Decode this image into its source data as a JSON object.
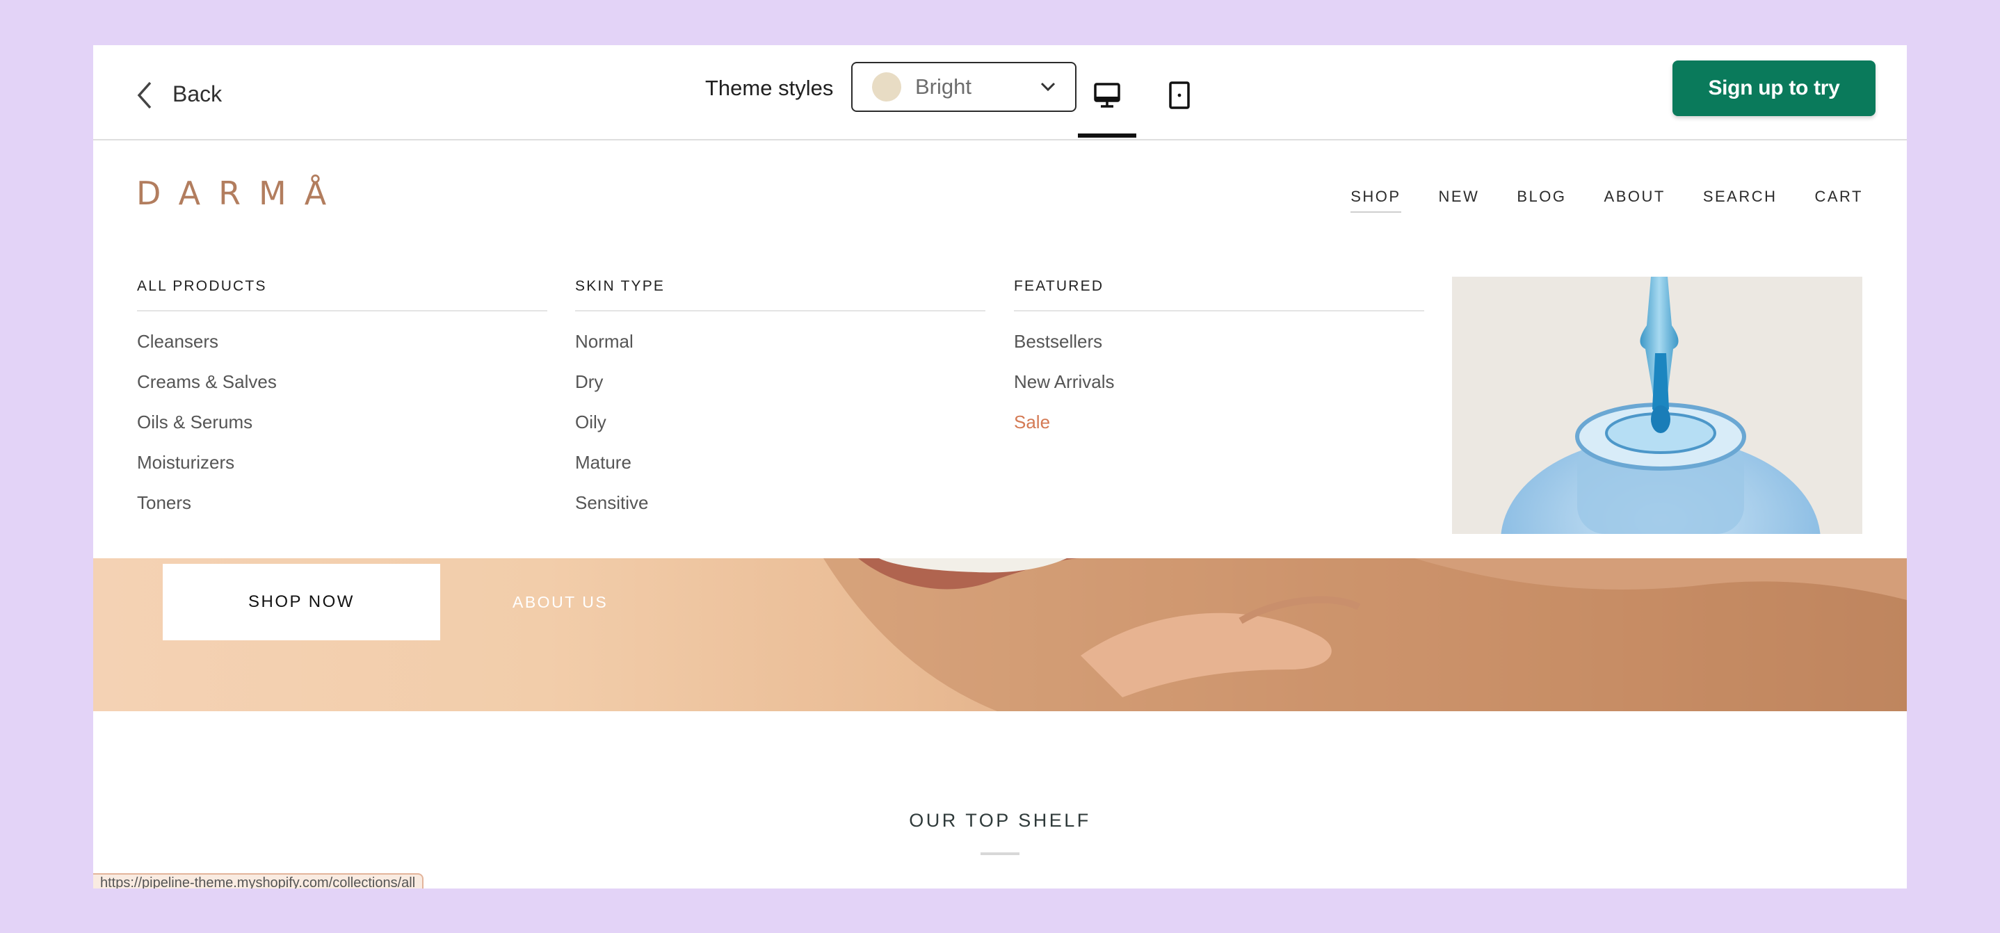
{
  "toolbar": {
    "back_label": "Back",
    "theme_label": "Theme styles",
    "theme_value": "Bright",
    "signup_label": "Sign up to try"
  },
  "store": {
    "logo": "DARMÅ",
    "nav": [
      "SHOP",
      "NEW",
      "BLOG",
      "ABOUT",
      "SEARCH",
      "CART"
    ]
  },
  "menu": {
    "columns": [
      {
        "heading": "ALL PRODUCTS",
        "items": [
          "Cleansers",
          "Creams & Salves",
          "Oils & Serums",
          "Moisturizers",
          "Toners"
        ]
      },
      {
        "heading": "SKIN TYPE",
        "items": [
          "Normal",
          "Dry",
          "Oily",
          "Mature",
          "Sensitive"
        ]
      },
      {
        "heading": "FEATURED",
        "items": [
          "Bestsellers",
          "New Arrivals",
          "Sale"
        ]
      }
    ]
  },
  "hero": {
    "primary_button": "SHOP NOW",
    "secondary_link": "ABOUT US"
  },
  "section": {
    "title": "OUR TOP SHELF"
  },
  "status_bar": {
    "url": "https://pipeline-theme.myshopify.com/collections/all"
  },
  "colors": {
    "background": "#e3d3f7",
    "brand": "#b27d5e",
    "signup": "#0a7a5b",
    "sale": "#d47a54"
  },
  "icons": [
    "chevron-left-icon",
    "chevron-down-icon",
    "desktop-icon",
    "tablet-icon"
  ]
}
